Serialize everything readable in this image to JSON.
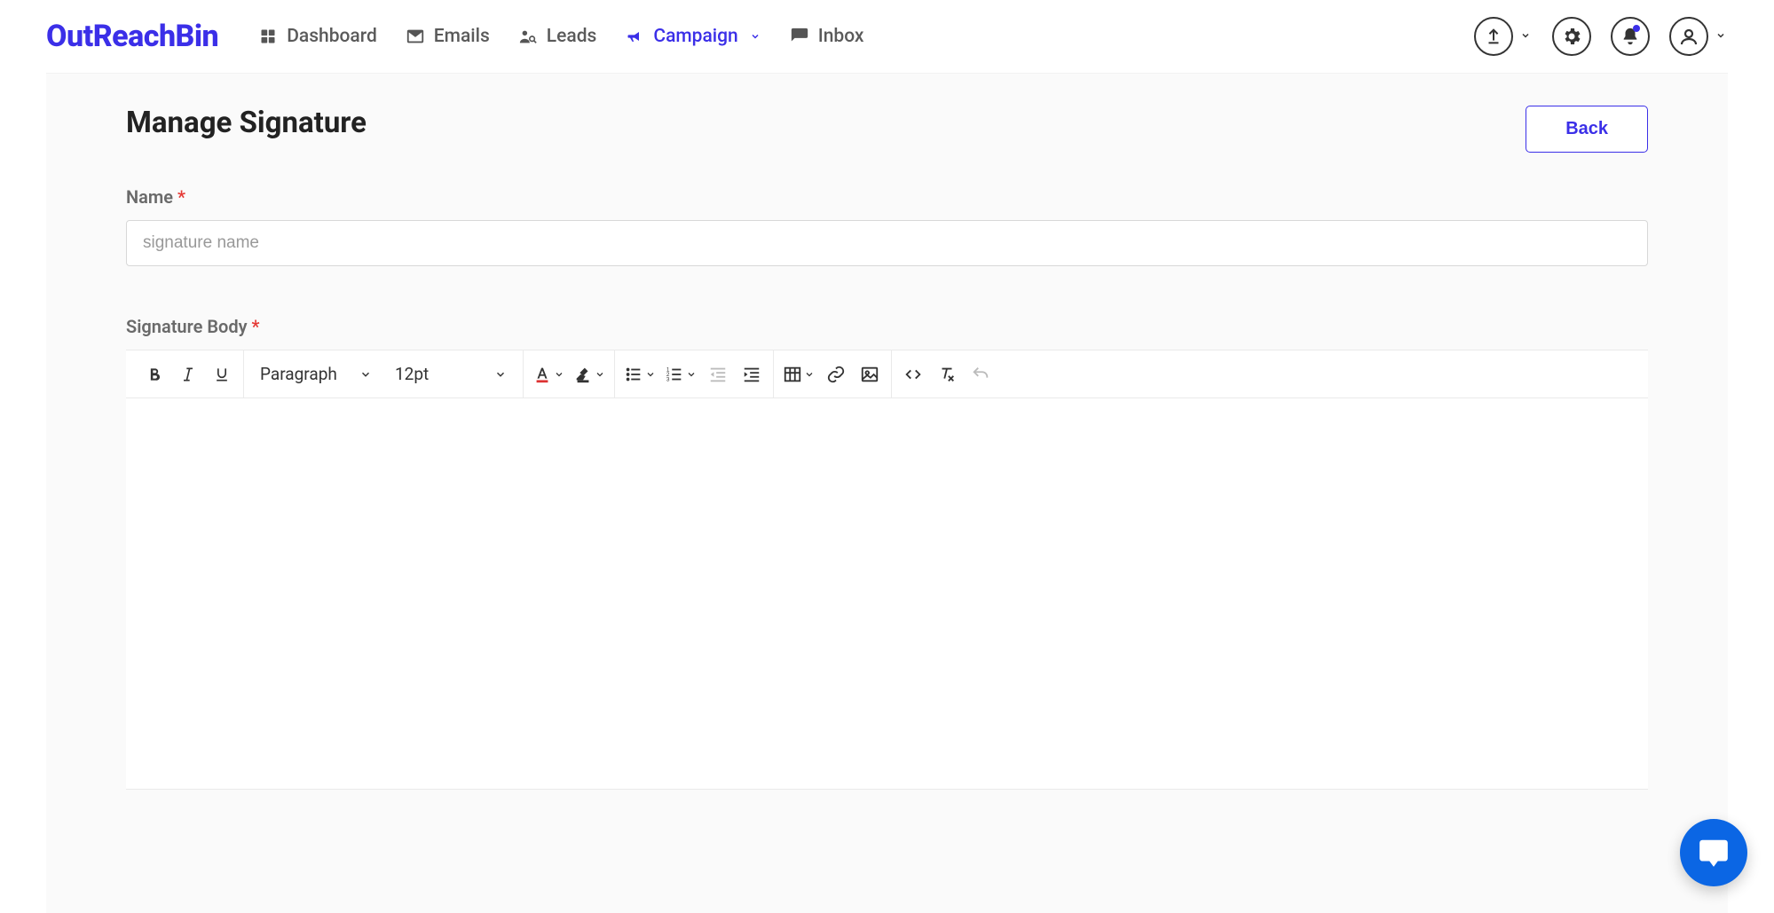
{
  "brand": {
    "name": "OutReachBin"
  },
  "nav": {
    "items": [
      {
        "label": "Dashboard",
        "icon": "grid-icon",
        "active": false,
        "hasDropdown": false
      },
      {
        "label": "Emails",
        "icon": "mail-icon",
        "active": false,
        "hasDropdown": false
      },
      {
        "label": "Leads",
        "icon": "people-search-icon",
        "active": false,
        "hasDropdown": false
      },
      {
        "label": "Campaign",
        "icon": "megaphone-icon",
        "active": true,
        "hasDropdown": true
      },
      {
        "label": "Inbox",
        "icon": "comment-icon",
        "active": false,
        "hasDropdown": false
      }
    ]
  },
  "header_actions": {
    "upload": {
      "icon": "upload-icon",
      "hasDropdown": true
    },
    "settings": {
      "icon": "gear-icon"
    },
    "notifications": {
      "icon": "bell-icon",
      "hasUnread": true
    },
    "profile": {
      "icon": "user-icon",
      "hasDropdown": true
    }
  },
  "page": {
    "title": "Manage Signature",
    "back_label": "Back"
  },
  "form": {
    "name": {
      "label": "Name",
      "required": "*",
      "placeholder": "signature name",
      "value": ""
    },
    "body": {
      "label": "Signature Body",
      "required": "*"
    }
  },
  "editor": {
    "block_format": "Paragraph",
    "font_size": "12pt",
    "buttons": {
      "bold": "bold-icon",
      "italic": "italic-icon",
      "underline": "underline-icon",
      "text_color": "text-color-icon",
      "highlight": "highlight-icon",
      "bullet_list": "bullet-list-icon",
      "numbered_list": "numbered-list-icon",
      "outdent": "outdent-icon",
      "indent": "indent-icon",
      "table": "table-icon",
      "link": "link-icon",
      "image": "image-icon",
      "code": "code-icon",
      "clear_format": "clear-format-icon",
      "undo": "undo-icon"
    }
  },
  "colors": {
    "accent": "#3B2FE8",
    "danger": "#e53935",
    "chat": "#0b66e4"
  }
}
